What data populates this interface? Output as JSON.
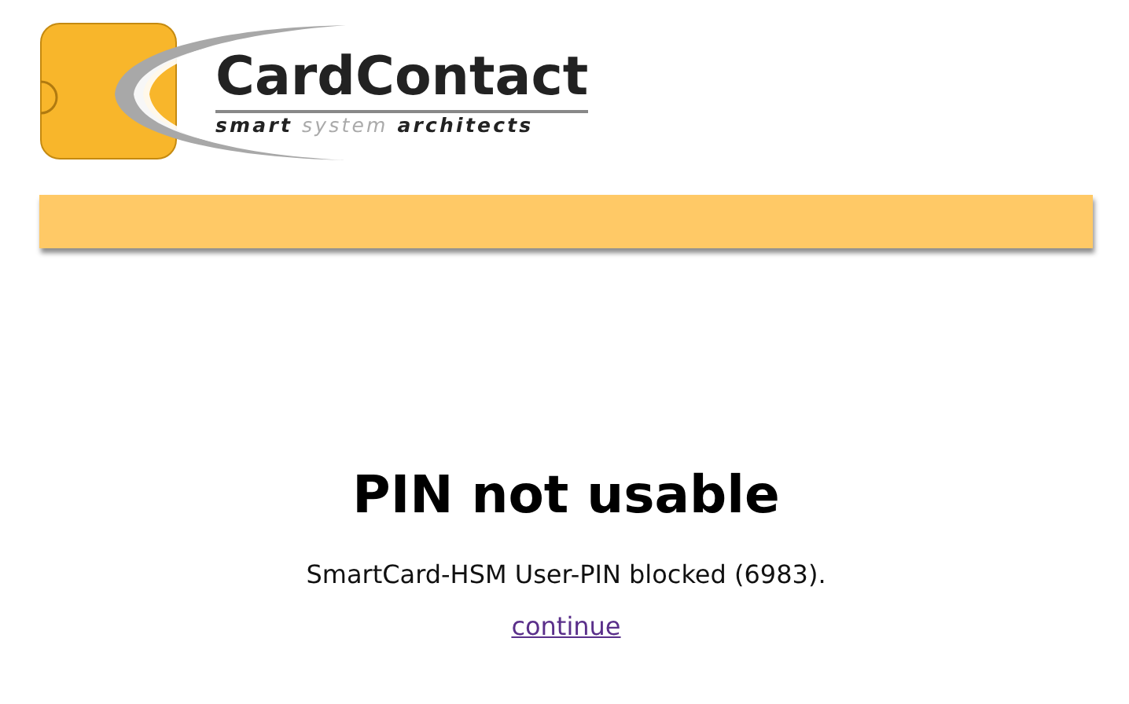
{
  "logo": {
    "name": "CardContact",
    "tagline": [
      {
        "text": "smart",
        "muted": false
      },
      {
        "text": "system",
        "muted": true
      },
      {
        "text": "architects",
        "muted": false
      }
    ]
  },
  "heading": "PIN not usable",
  "message": "SmartCard-HSM User-PIN blocked (6983).",
  "link": "continue"
}
